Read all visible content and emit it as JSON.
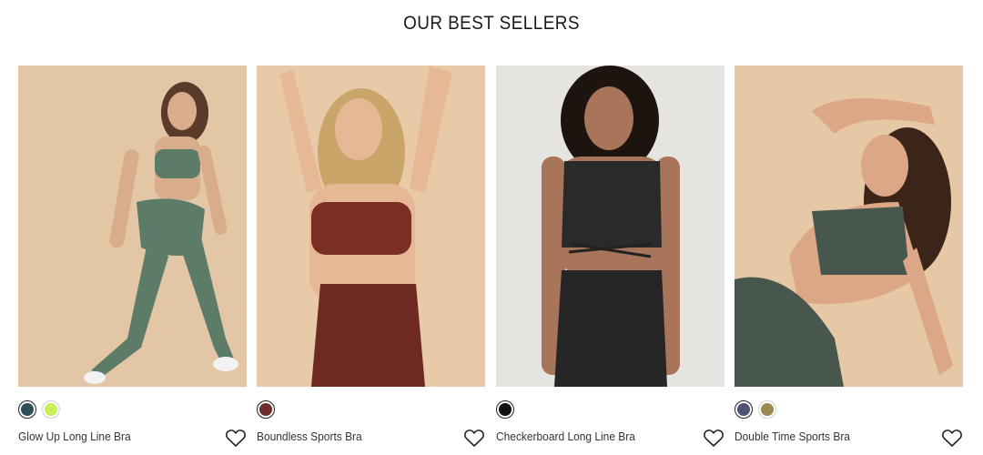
{
  "section": {
    "title": "OUR BEST SELLERS"
  },
  "products": [
    {
      "name": "Glow Up Long Line Bra",
      "photo": {
        "bg": "#e3c6a5",
        "top": "#5d7c68",
        "bottom": "#5d7c68",
        "skin": "#d9ad8c",
        "hair": "#5a3a28"
      },
      "swatches": [
        {
          "color": "#2f4f56"
        },
        {
          "color": "#c8ef5a"
        }
      ]
    },
    {
      "name": "Boundless Sports Bra",
      "photo": {
        "bg": "#e8c9a8",
        "top": "#7a2e24",
        "bottom": "#6e2a22",
        "skin": "#e6b896",
        "hair": "#c9a56a"
      },
      "swatches": [
        {
          "color": "#6e2f2c"
        }
      ]
    },
    {
      "name": "Checkerboard Long Line Bra",
      "photo": {
        "bg": "#e6e4e1",
        "top": "#2a2a2a",
        "bottom": "#262626",
        "skin": "#a8745a",
        "hair": "#1d1410"
      },
      "swatches": [
        {
          "color": "#111111"
        }
      ]
    },
    {
      "name": "Double Time Sports Bra",
      "photo": {
        "bg": "#e6c8a6",
        "top": "#48574e",
        "bottom": "#48574e",
        "skin": "#dba787",
        "hair": "#3b2418"
      },
      "swatches": [
        {
          "color": "#4d5370"
        },
        {
          "color": "#9b8a52"
        }
      ]
    }
  ],
  "icons": {
    "wishlist": "heart-outline-icon"
  }
}
